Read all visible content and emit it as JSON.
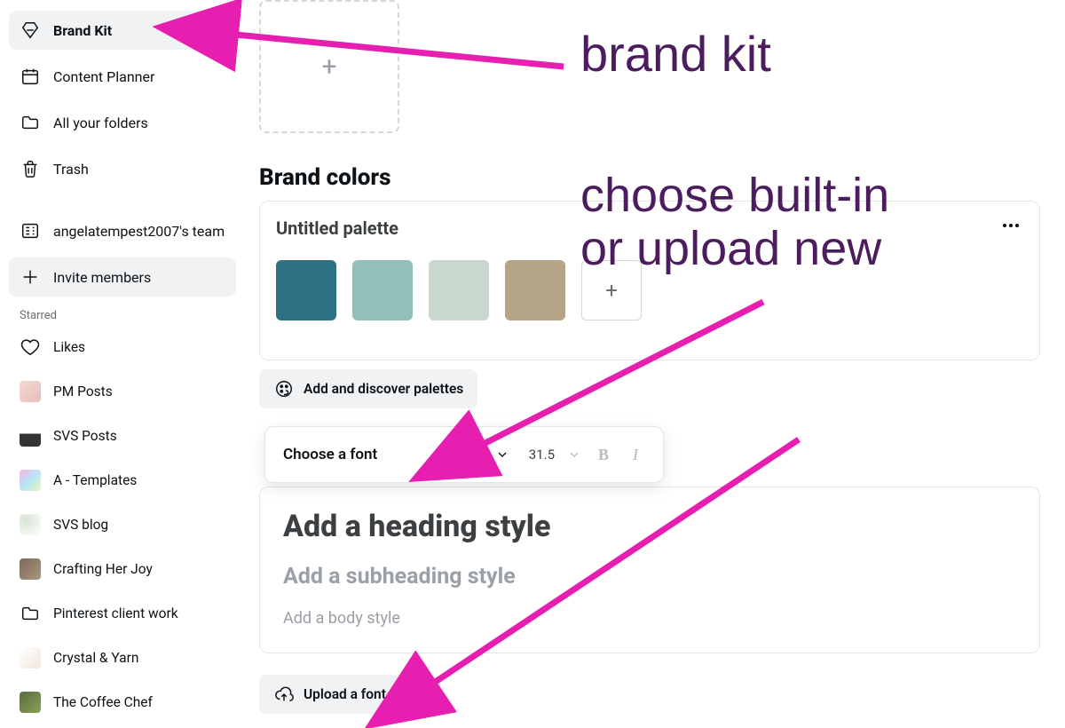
{
  "sidebar": {
    "nav": {
      "brandKit": "Brand Kit",
      "contentPlanner": "Content Planner",
      "folders": "All your folders",
      "trash": "Trash",
      "team": "angelatempest2007's team",
      "invite": "Invite members"
    },
    "starredHeading": "Starred",
    "starred": {
      "likes": "Likes",
      "pm": "PM Posts",
      "svs": "SVS Posts",
      "atpl": "A - Templates",
      "blog": "SVS blog",
      "joy": "Crafting Her Joy",
      "pin": "Pinterest client work",
      "yarn": "Crystal & Yarn",
      "chef": "The Coffee Chef"
    }
  },
  "main": {
    "brandColorsTitle": "Brand colors",
    "paletteName": "Untitled palette",
    "paletteColors": [
      "#2d7184",
      "#90bfbc",
      "#c8d8cf",
      "#b5a586"
    ],
    "addPalettesLabel": "Add and discover palettes",
    "fontToolbar": {
      "fontLabel": "Choose a font",
      "sizeValue": "31.5"
    },
    "fontStyles": {
      "heading": "Add a heading style",
      "subheading": "Add a subheading style",
      "body": "Add a body style"
    },
    "uploadFontLabel": "Upload a font"
  },
  "annotations": {
    "a1": "brand kit",
    "a2_line1": "choose built-in",
    "a2_line2": "or upload new"
  }
}
